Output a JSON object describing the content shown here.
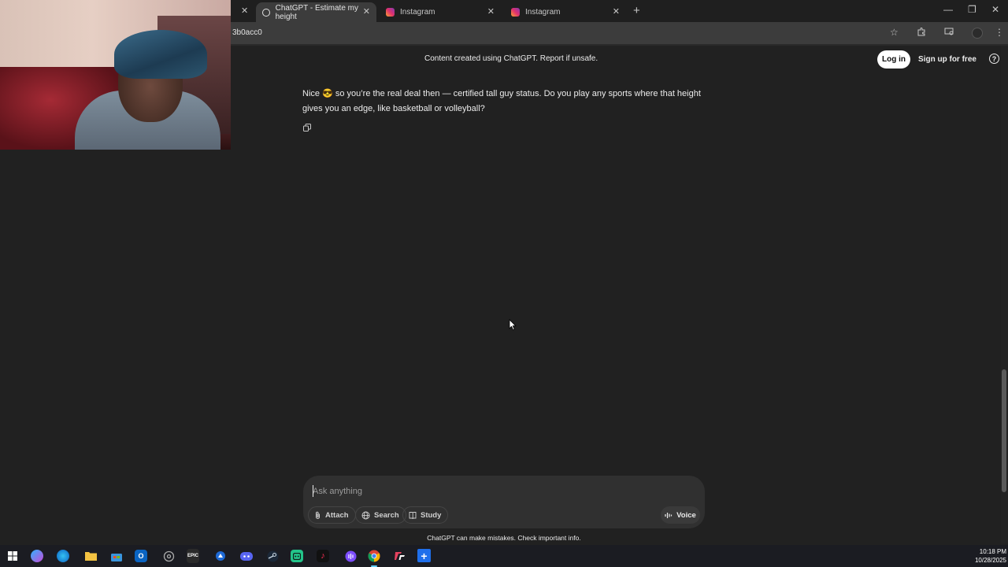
{
  "browser": {
    "tabs": [
      {
        "title": "ChatGPT - Estimate my height",
        "icon": "chatgpt-icon",
        "active": true
      },
      {
        "title": "Instagram",
        "icon": "instagram-icon",
        "active": false
      },
      {
        "title": "Instagram",
        "icon": "instagram-icon",
        "active": false
      }
    ],
    "url": "3b0acc0"
  },
  "header": {
    "notice_prefix": "Content created using ChatGPT.",
    "notice_link": "Report",
    "notice_suffix": "if unsafe.",
    "login_label": "Log in",
    "signup_label": "Sign up for free",
    "help_label": "?"
  },
  "conversation": {
    "assistant_message": "Nice 😎 so you’re the real deal then — certified tall guy status. Do you play any sports where that height gives you an edge, like basketball or volleyball?"
  },
  "composer": {
    "placeholder": "Ask anything",
    "attach_label": "Attach",
    "search_label": "Search",
    "study_label": "Study",
    "voice_label": "Voice"
  },
  "disclaimer": "ChatGPT can make mistakes. Check important info.",
  "taskbar": {
    "apps": [
      "windows-start-icon",
      "copilot-icon",
      "edge-icon",
      "file-explorer-icon",
      "microsoft-store-icon",
      "outlook-icon",
      "origin-icon",
      "epic-games-icon",
      "app-icon",
      "discord-icon",
      "steam-icon",
      "app-icon",
      "tiktok-icon",
      "app-icon",
      "chrome-icon",
      "app-icon",
      "app-icon"
    ],
    "epic_label": "EPIC",
    "time": "10:18 PM",
    "date": "10/28/2025"
  },
  "colors": {
    "page_bg": "#212121",
    "composer_bg": "#303030",
    "tab_active_bg": "#3c3c3c"
  }
}
